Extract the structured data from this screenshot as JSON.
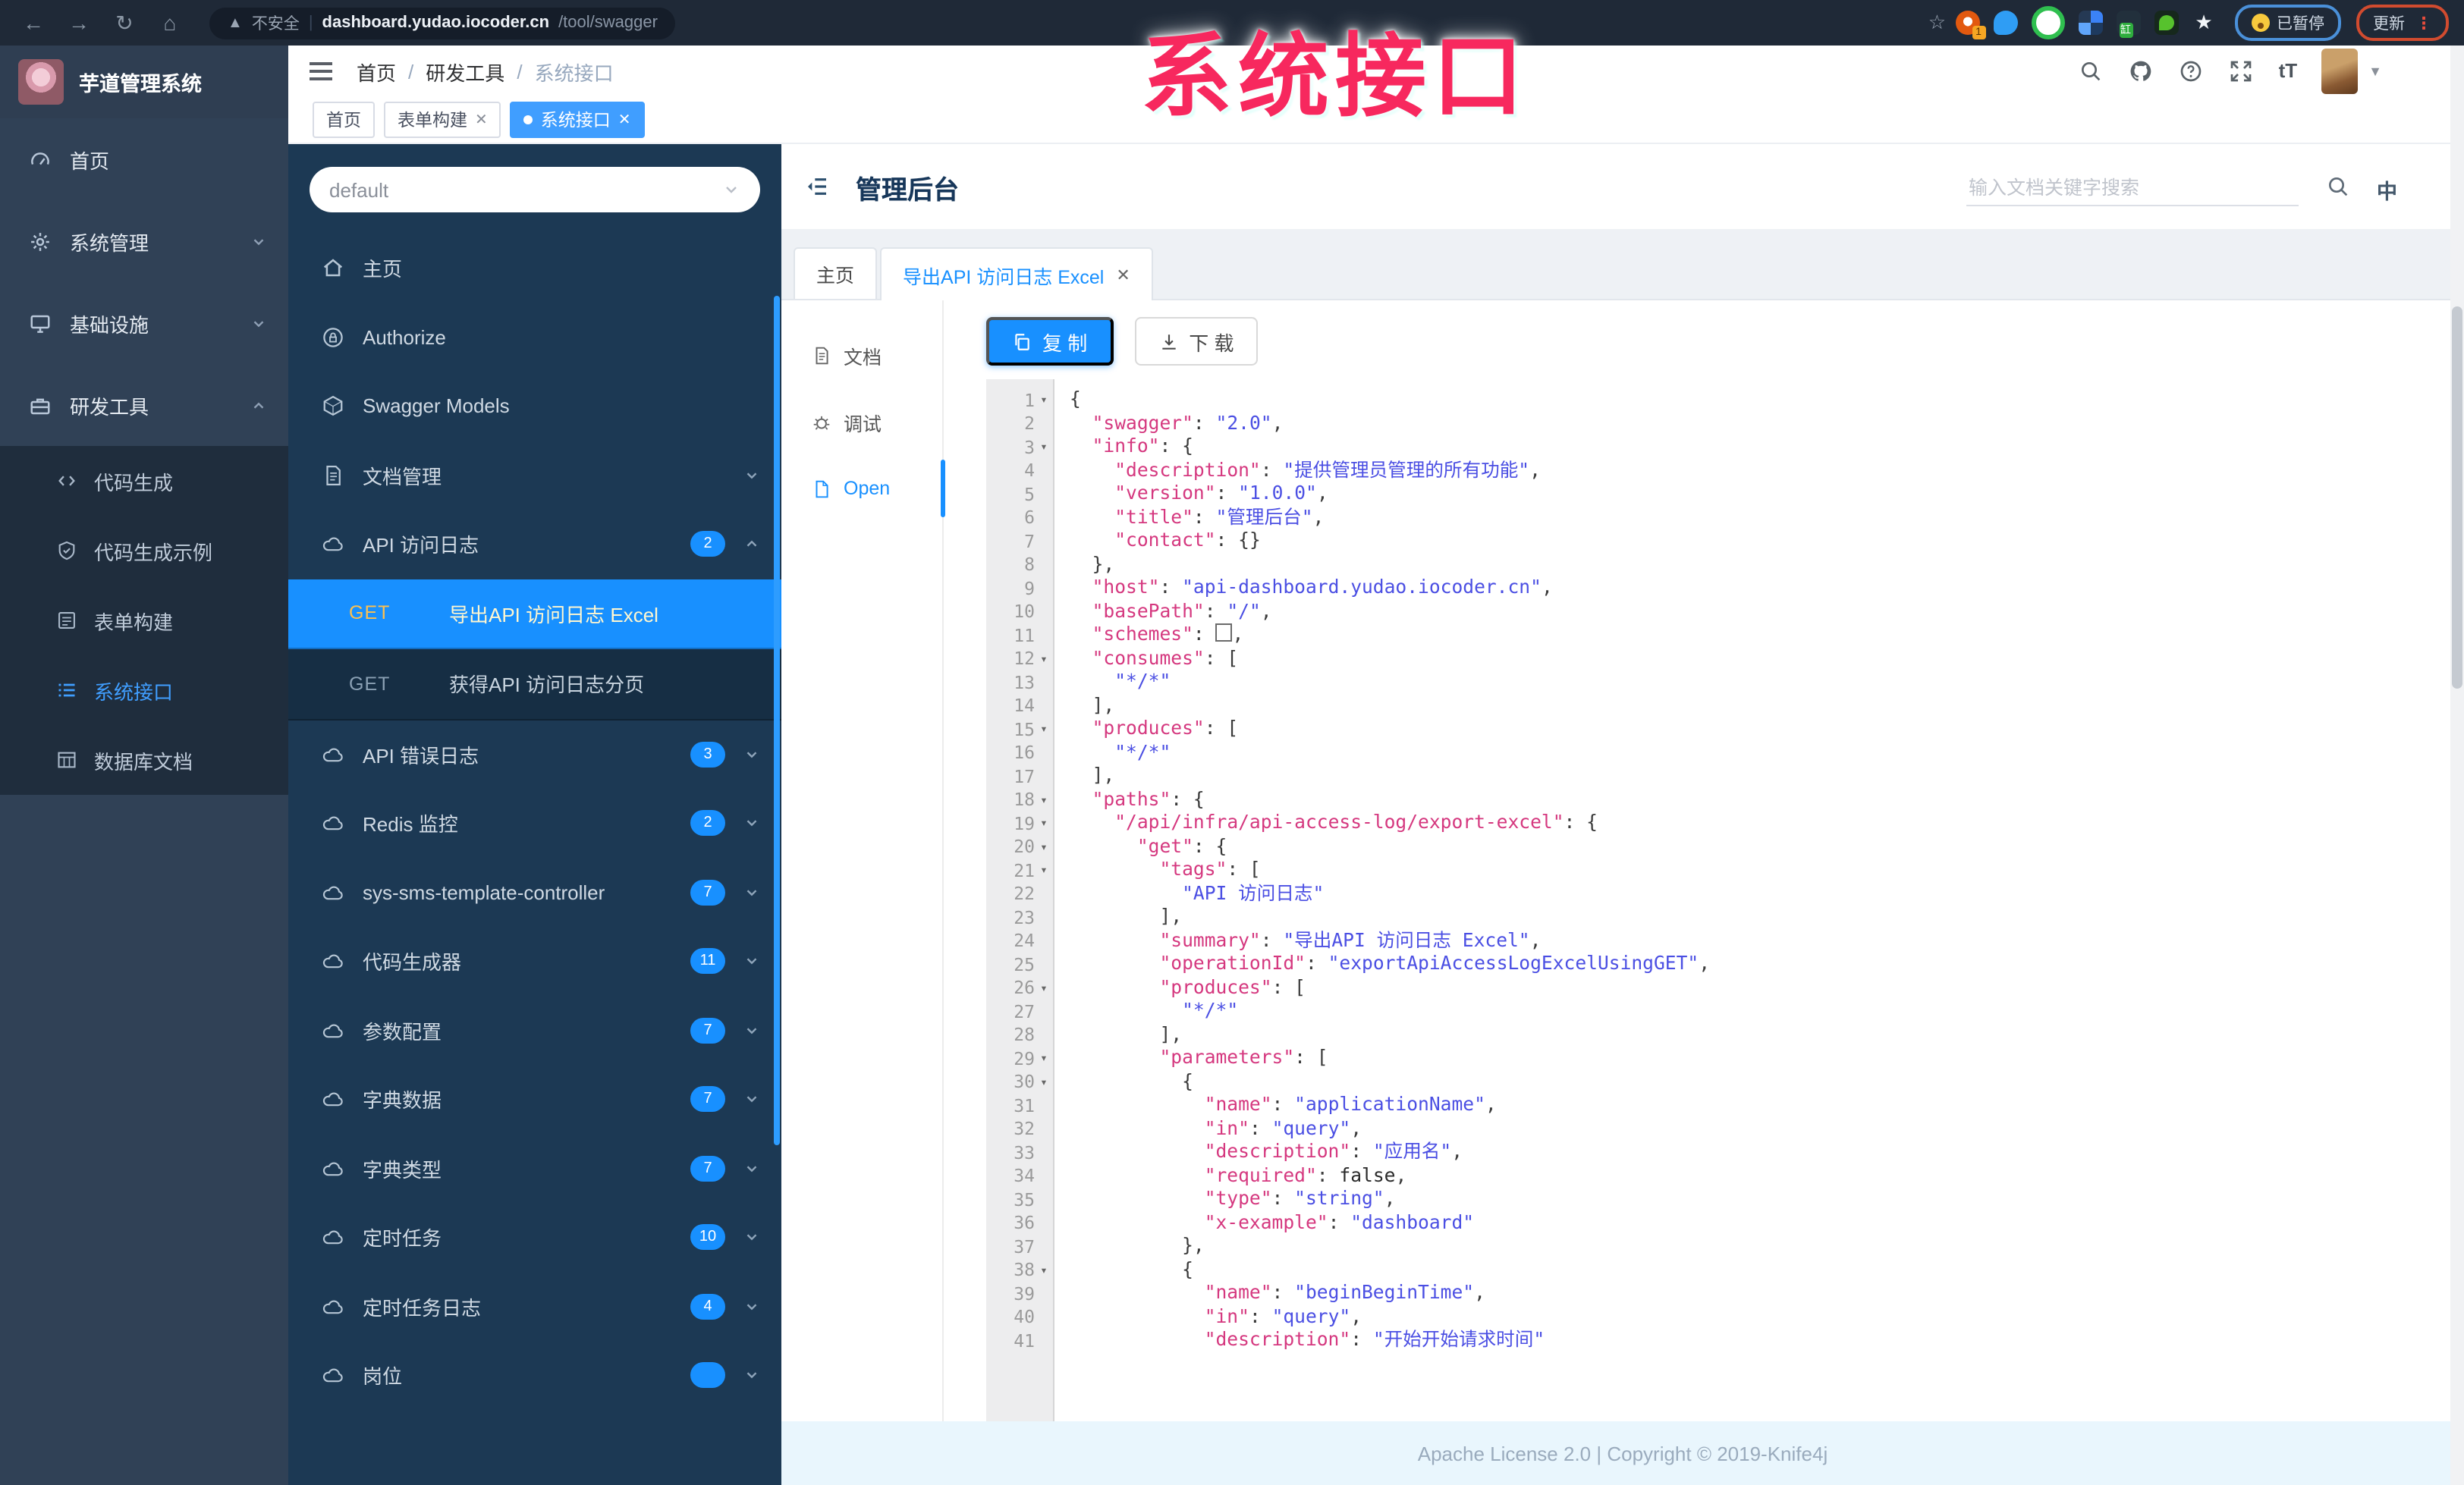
{
  "browser": {
    "security_label": "不安全",
    "url_host": "dashboard.yudao.iocoder.cn",
    "url_path": "/tool/swagger",
    "pill_paused": "已暂停",
    "pill_update": "更新",
    "ext_badge": "1",
    "ext_tag": "缸"
  },
  "watermark": "系统接口",
  "sidebar": {
    "logo_title": "芋道管理系统",
    "items": [
      {
        "icon": "gauge",
        "label": "首页"
      },
      {
        "icon": "gear",
        "label": "系统管理",
        "chevron": "down"
      },
      {
        "icon": "infra",
        "label": "基础设施",
        "chevron": "down"
      },
      {
        "icon": "tools",
        "label": "研发工具",
        "chevron": "up"
      }
    ],
    "sub_items": [
      {
        "icon": "code",
        "label": "代码生成"
      },
      {
        "icon": "shield",
        "label": "代码生成示例"
      },
      {
        "icon": "form",
        "label": "表单构建"
      },
      {
        "icon": "list",
        "label": "系统接口",
        "active": true
      },
      {
        "icon": "table",
        "label": "数据库文档"
      }
    ]
  },
  "navbar": {
    "breadcrumb": [
      "首页",
      "研发工具",
      "系统接口"
    ]
  },
  "tags": [
    {
      "label": "首页"
    },
    {
      "label": "表单构建",
      "closable": true
    },
    {
      "label": "系统接口",
      "closable": true,
      "active": true
    }
  ],
  "swagger_panel": {
    "group_select": "default",
    "rows": [
      {
        "type": "item",
        "icon": "home",
        "label": "主页"
      },
      {
        "type": "item",
        "icon": "lock",
        "label": "Authorize"
      },
      {
        "type": "item",
        "icon": "models",
        "label": "Swagger Models"
      },
      {
        "type": "group",
        "icon": "doc",
        "label": "文档管理",
        "chevron": "down"
      },
      {
        "type": "group",
        "icon": "cloud",
        "label": "API 访问日志",
        "badge": "2",
        "chevron": "up"
      },
      {
        "type": "api",
        "method": "GET",
        "label": "导出API 访问日志 Excel",
        "active": true
      },
      {
        "type": "api",
        "method": "GET",
        "label": "获得API 访问日志分页"
      },
      {
        "type": "group",
        "icon": "cloud",
        "label": "API 错误日志",
        "badge": "3",
        "chevron": "down"
      },
      {
        "type": "group",
        "icon": "cloud",
        "label": "Redis 监控",
        "badge": "2",
        "chevron": "down"
      },
      {
        "type": "group",
        "icon": "cloud",
        "label": "sys-sms-template-controller",
        "badge": "7",
        "chevron": "down"
      },
      {
        "type": "group",
        "icon": "cloud",
        "label": "代码生成器",
        "badge": "11",
        "chevron": "down"
      },
      {
        "type": "group",
        "icon": "cloud",
        "label": "参数配置",
        "badge": "7",
        "chevron": "down"
      },
      {
        "type": "group",
        "icon": "cloud",
        "label": "字典数据",
        "badge": "7",
        "chevron": "down"
      },
      {
        "type": "group",
        "icon": "cloud",
        "label": "字典类型",
        "badge": "7",
        "chevron": "down"
      },
      {
        "type": "group",
        "icon": "cloud",
        "label": "定时任务",
        "badge": "10",
        "chevron": "down"
      },
      {
        "type": "group",
        "icon": "cloud",
        "label": "定时任务日志",
        "badge": "4",
        "chevron": "down"
      },
      {
        "type": "group",
        "icon": "cloud",
        "label": "岗位",
        "badge": "",
        "chevron": "down"
      }
    ]
  },
  "main": {
    "title": "管理后台",
    "search_placeholder": "输入文档关键字搜索",
    "lang_icon": "中",
    "tabs": [
      {
        "label": "主页"
      },
      {
        "label": "导出API 访问日志 Excel",
        "active": true,
        "closable": true
      }
    ],
    "side_tabs": [
      {
        "icon": "doc",
        "label": "文档"
      },
      {
        "icon": "bug",
        "label": "调试"
      },
      {
        "icon": "file",
        "label": "Open",
        "active": true
      }
    ],
    "copy_label": "复 制",
    "download_label": "下 载",
    "footer": "Apache License 2.0 | Copyright © 2019-Knife4j"
  },
  "editor": {
    "fold_lines": [
      1,
      3,
      12,
      15,
      18,
      19,
      20,
      21,
      26,
      29,
      30,
      38
    ],
    "lines": [
      "{",
      "  \"swagger\": \"2.0\",",
      "  \"info\": {",
      "    \"description\": \"提供管理员管理的所有功能\",",
      "    \"version\": \"1.0.0\",",
      "    \"title\": \"管理后台\",",
      "    \"contact\": {}",
      "  },",
      "  \"host\": \"api-dashboard.yudao.iocoder.cn\",",
      "  \"basePath\": \"/\",",
      "  \"schemes\": [],",
      "  \"consumes\": [",
      "    \"*/*\"",
      "  ],",
      "  \"produces\": [",
      "    \"*/*\"",
      "  ],",
      "  \"paths\": {",
      "    \"/api/infra/api-access-log/export-excel\": {",
      "      \"get\": {",
      "        \"tags\": [",
      "          \"API 访问日志\"",
      "        ],",
      "        \"summary\": \"导出API 访问日志 Excel\",",
      "        \"operationId\": \"exportApiAccessLogExcelUsingGET\",",
      "        \"produces\": [",
      "          \"*/*\"",
      "        ],",
      "        \"parameters\": [",
      "          {",
      "            \"name\": \"applicationName\",",
      "            \"in\": \"query\",",
      "            \"description\": \"应用名\",",
      "            \"required\": false,",
      "            \"type\": \"string\",",
      "            \"x-example\": \"dashboard\"",
      "          },",
      "          {",
      "            \"name\": \"beginBeginTime\",",
      "            \"in\": \"query\",",
      "            \"description\": \"开始开始请求时间\""
    ]
  },
  "colors": {
    "accent_blue": "#1890ff",
    "element_blue": "#409eff",
    "sidebar_bg": "#304156",
    "submenu_bg": "#1f2d3d",
    "kside_bg": "#1c3954",
    "key_pink": "#d5387f",
    "value_blue": "#4b4fe3",
    "watermark_pink": "#f7285e"
  }
}
